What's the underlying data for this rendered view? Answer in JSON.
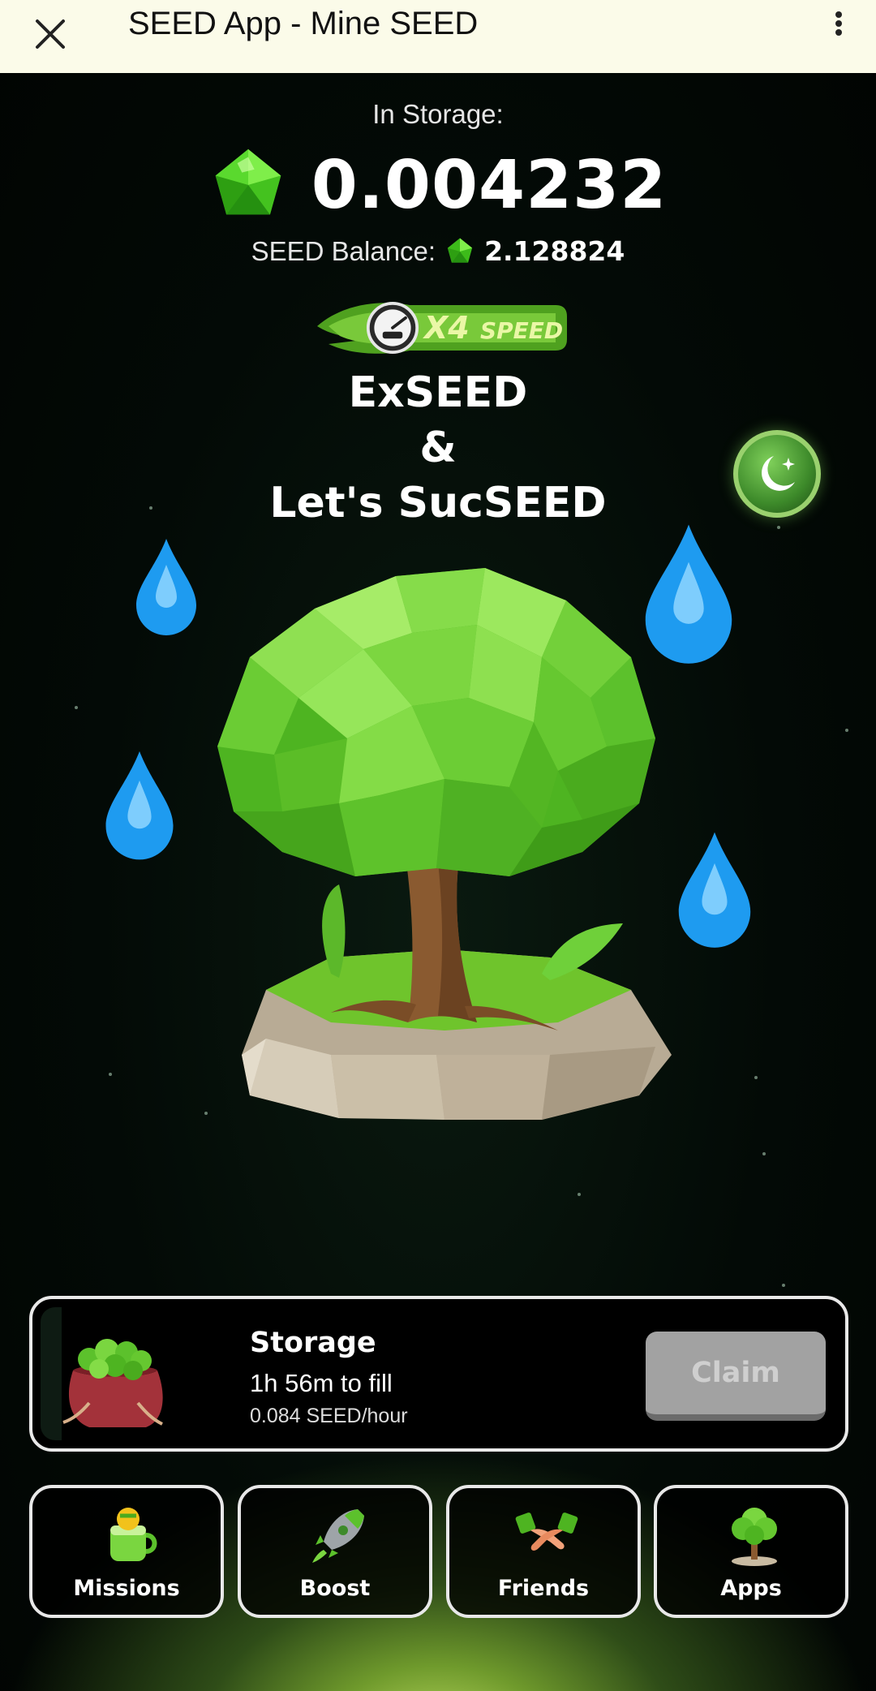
{
  "topbar": {
    "title": "SEED App - Mine SEED",
    "close_icon": "close-icon",
    "more_icon": "more-vertical-icon"
  },
  "header": {
    "in_storage_label": "In Storage:",
    "storage_value": "0.004232",
    "balance_label": "SEED Balance:",
    "balance_value": "2.128824"
  },
  "speed_badge": {
    "multiplier": "X4",
    "label": "SPEED",
    "gauge_text": "SPEED"
  },
  "motto": {
    "line1": "ExSEED",
    "line2": "&",
    "line3": "Let's SucSEED"
  },
  "storage_card": {
    "title": "Storage",
    "fill_time": "1h 56m to fill",
    "rate": "0.084 SEED/hour",
    "claim_label": "Claim"
  },
  "nav": {
    "items": [
      {
        "label": "Missions",
        "icon": "missions-icon"
      },
      {
        "label": "Boost",
        "icon": "rocket-icon"
      },
      {
        "label": "Friends",
        "icon": "handshake-icon"
      },
      {
        "label": "Apps",
        "icon": "tree-icon"
      }
    ]
  },
  "colors": {
    "topbar_bg": "#fbfbe9",
    "background": "#020806",
    "gem_green": "#4cd424",
    "drop_blue": "#1e9bf0",
    "claim_disabled": "#a2a2a2"
  }
}
